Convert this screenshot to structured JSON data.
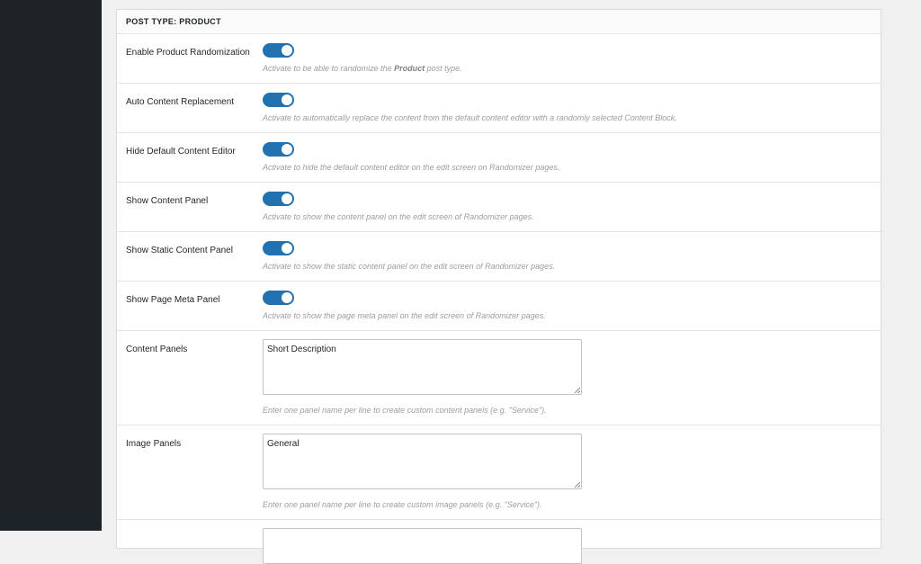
{
  "panel": {
    "title": "POST TYPE: PRODUCT"
  },
  "settings": [
    {
      "label": "Enable Product Randomization",
      "type": "toggle",
      "enabled": true,
      "desc_before": "Activate to be able to randomize the ",
      "desc_bold": "Product",
      "desc_after": " post type."
    },
    {
      "label": "Auto Content Replacement",
      "type": "toggle",
      "enabled": true,
      "desc_before": "Activate to automatically replace the content from the default content editor with a randomly selected Content Block."
    },
    {
      "label": "Hide Default Content Editor",
      "type": "toggle",
      "enabled": true,
      "desc_before": "Activate to hide the default content editor on the edit screen on Randomizer pages."
    },
    {
      "label": "Show Content Panel",
      "type": "toggle",
      "enabled": true,
      "desc_before": "Activate to show the content panel on the edit screen of Randomizer pages."
    },
    {
      "label": "Show Static Content Panel",
      "type": "toggle",
      "enabled": true,
      "desc_before": "Activate to show the static content panel on the edit screen of Randomizer pages."
    },
    {
      "label": "Show Page Meta Panel",
      "type": "toggle",
      "enabled": true,
      "desc_before": "Activate to show the page meta panel on the edit screen of Randomizer pages."
    },
    {
      "label": "Content Panels",
      "type": "textarea",
      "value": "Short Description",
      "desc_before": "Enter one panel name per line to create custom content panels (e.g. \"Service\")."
    },
    {
      "label": "Image Panels",
      "type": "textarea",
      "value": "General",
      "desc_before": "Enter one panel name per line to create custom image panels (e.g. \"Service\")."
    }
  ],
  "colors": {
    "toggle_on": "#2271b1",
    "sidebar": "#1d2327"
  }
}
